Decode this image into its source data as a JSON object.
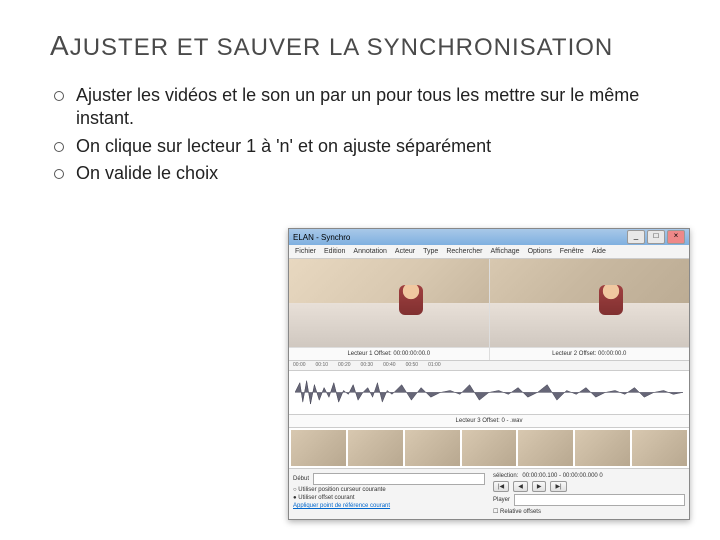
{
  "title_first": "A",
  "title_rest": "JUSTER ET SAUVER LA SYNCHRONISATION",
  "bullets": [
    "Ajuster les vidéos et le son un par un pour tous les mettre sur le même instant.",
    "On clique sur lecteur 1 à 'n' et on ajuste séparément",
    "On valide le choix"
  ],
  "window": {
    "title": "ELAN - Synchro",
    "btn_min": "_",
    "btn_max": "□",
    "btn_close": "×",
    "menu": [
      "Fichier",
      "Edition",
      "Annotation",
      "Acteur",
      "Type",
      "Rechercher",
      "Affichage",
      "Options",
      "Fenêtre",
      "Aide"
    ],
    "video1_label": "Lecteur 1 Offset: 00:00:00:00.0",
    "video2_label": "Lecteur 2 Offset: 00:00:00.0",
    "timeline_marks": [
      "00:00",
      "00:10",
      "00:20",
      "00:30",
      "00:40",
      "00:50",
      "01:00"
    ],
    "wave_label": "Lecteur 3 Offset: 0 -  .wav",
    "panel": {
      "debut_label": "Début",
      "radio1": "Utiliser position curseur courante",
      "radio2": "Utiliser offset courant",
      "link": "Appliquer point de référence courant",
      "selection_label": "sélection:",
      "selection_value": "00:00:00.100 - 00:00:00.000  0",
      "player_label": "Player",
      "relative": "Relative offsets"
    }
  }
}
